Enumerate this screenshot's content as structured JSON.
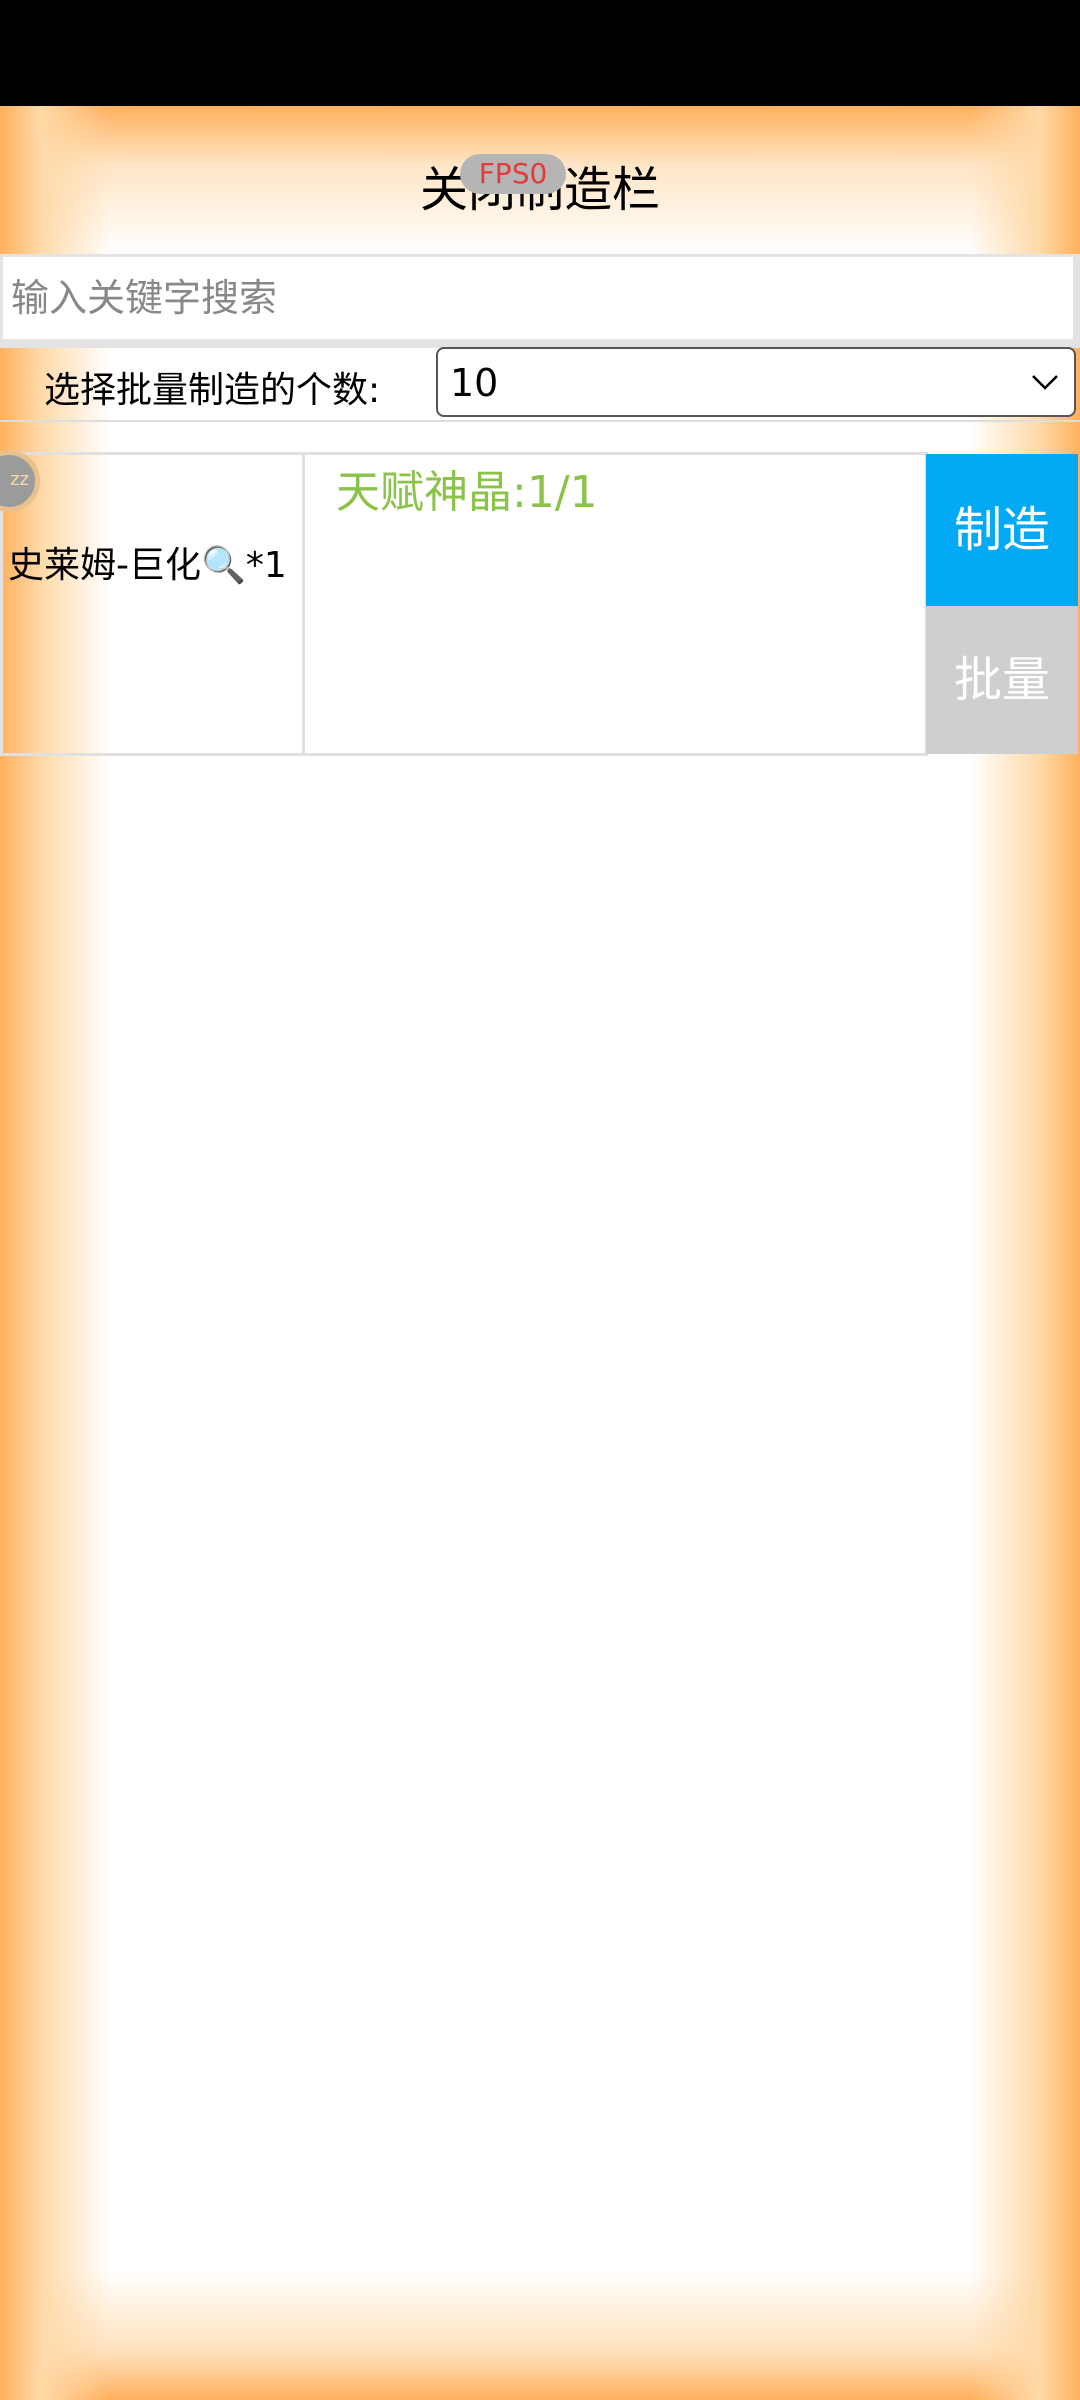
{
  "header": {
    "title": "关闭制造栏"
  },
  "search": {
    "placeholder": "输入关键字搜索"
  },
  "fps_badge": "FPS0",
  "batch": {
    "label": "选择批量制造的个数:",
    "selected_value": "10"
  },
  "recipe": {
    "name": "史莱姆-巨化🔍*1",
    "requirement": "天赋神晶:1/1",
    "avatar_text": "zz",
    "make_label": "制造",
    "batch_label": "批量"
  },
  "colors": {
    "make_button": "#03a9f4",
    "batch_button": "#cfcfcf",
    "requirement_text": "#8bc34a",
    "fps_text": "#e23b3b",
    "frame_glow": "#ffb05c"
  },
  "icons": {
    "select_arrow": "chevron-down-icon",
    "recipe_avatar": "avatar"
  }
}
